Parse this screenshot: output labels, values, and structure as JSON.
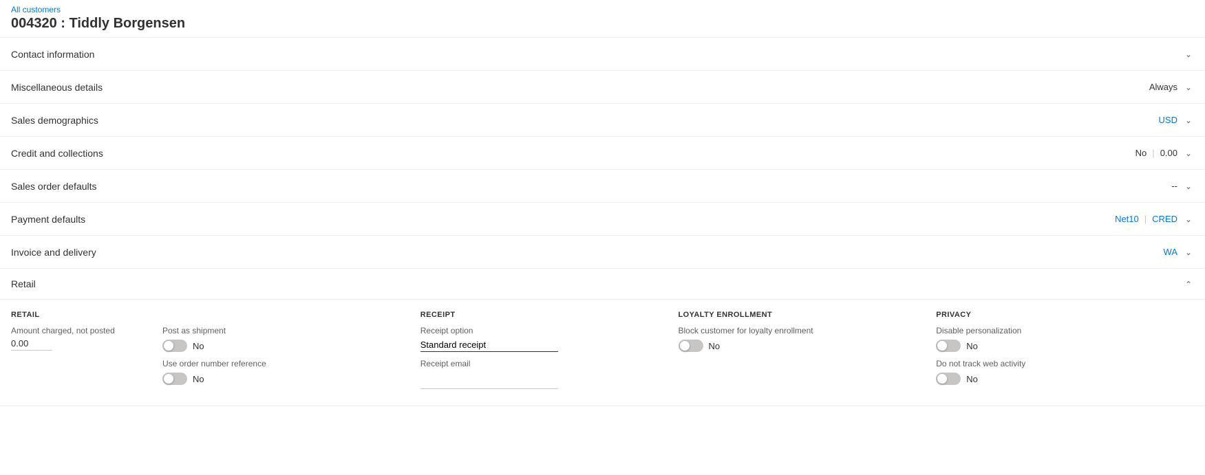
{
  "breadcrumb": {
    "link_text": "All customers"
  },
  "page_title": "004320 : Tiddly Borgensen",
  "sections": [
    {
      "id": "contact",
      "title": "Contact information",
      "meta": [],
      "expanded": false,
      "chevron": "down"
    },
    {
      "id": "misc",
      "title": "Miscellaneous details",
      "meta": [
        {
          "text": "Always",
          "type": "normal"
        }
      ],
      "expanded": false,
      "chevron": "down"
    },
    {
      "id": "sales-demo",
      "title": "Sales demographics",
      "meta": [
        {
          "text": "USD",
          "type": "blue"
        }
      ],
      "expanded": false,
      "chevron": "down"
    },
    {
      "id": "credit",
      "title": "Credit and collections",
      "meta": [
        {
          "text": "No",
          "type": "normal"
        },
        {
          "text": "|",
          "type": "divider"
        },
        {
          "text": "0.00",
          "type": "normal"
        }
      ],
      "expanded": false,
      "chevron": "down"
    },
    {
      "id": "sales-order",
      "title": "Sales order defaults",
      "meta": [
        {
          "text": "--",
          "type": "normal"
        }
      ],
      "expanded": false,
      "chevron": "down"
    },
    {
      "id": "payment",
      "title": "Payment defaults",
      "meta": [
        {
          "text": "Net10",
          "type": "blue"
        },
        {
          "text": "|",
          "type": "divider"
        },
        {
          "text": "CRED",
          "type": "blue"
        }
      ],
      "expanded": false,
      "chevron": "down"
    },
    {
      "id": "invoice",
      "title": "Invoice and delivery",
      "meta": [
        {
          "text": "WA",
          "type": "blue"
        }
      ],
      "expanded": false,
      "chevron": "down"
    }
  ],
  "retail_section": {
    "title": "Retail",
    "expanded": true,
    "chevron": "up",
    "retail_col": {
      "header": "RETAIL",
      "amount_label": "Amount charged, not posted",
      "amount_value": "0.00"
    },
    "shipment_col": {
      "post_as_shipment_label": "Post as shipment",
      "post_as_shipment_value": "No",
      "post_as_shipment_toggle": false,
      "use_order_ref_label": "Use order number reference",
      "use_order_ref_value": "No",
      "use_order_ref_toggle": false
    },
    "receipt_col": {
      "header": "RECEIPT",
      "receipt_option_label": "Receipt option",
      "receipt_option_value": "Standard receipt",
      "receipt_email_label": "Receipt email",
      "receipt_email_value": ""
    },
    "loyalty_col": {
      "header": "LOYALTY ENROLLMENT",
      "block_label": "Block customer for loyalty enrollment",
      "block_value": "No",
      "block_toggle": false
    },
    "privacy_col": {
      "header": "PRIVACY",
      "disable_personalization_label": "Disable personalization",
      "disable_personalization_value": "No",
      "disable_personalization_toggle": false,
      "do_not_track_label": "Do not track web activity",
      "do_not_track_value": "No",
      "do_not_track_toggle": false
    }
  }
}
